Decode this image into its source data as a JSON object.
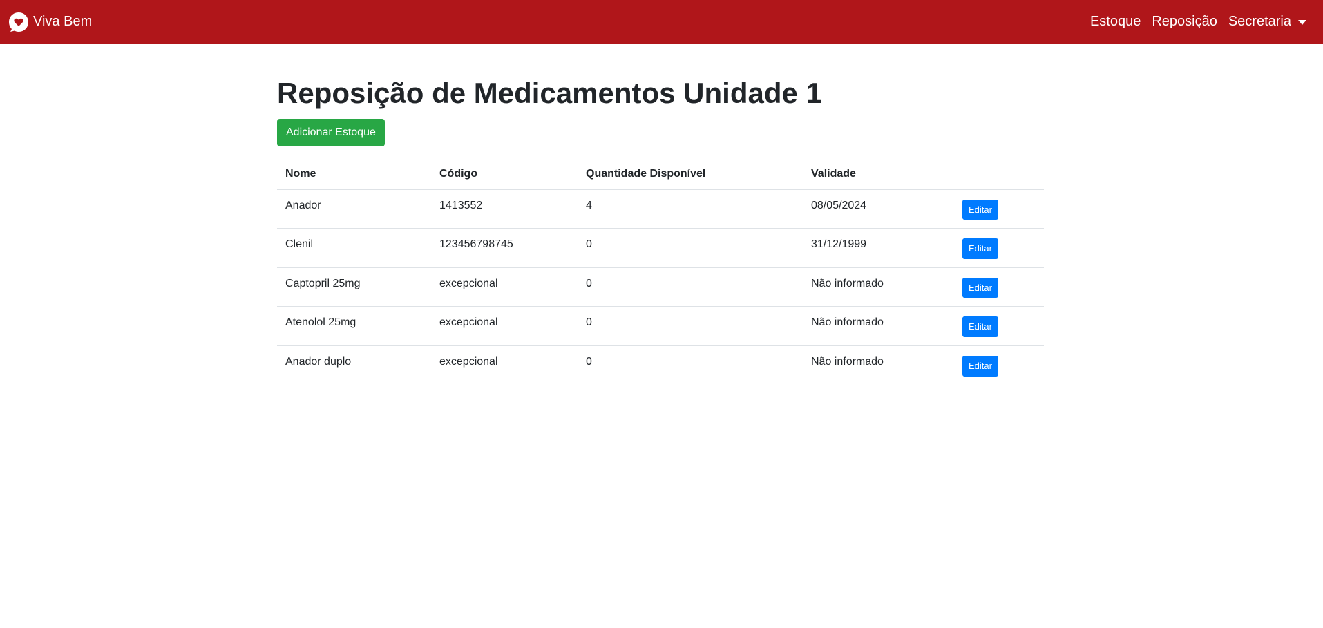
{
  "navbar": {
    "brand": "Viva Bem",
    "brand_icon": "heart-chat-icon",
    "links": [
      {
        "label": "Estoque"
      },
      {
        "label": "Reposição"
      }
    ],
    "dropdown_label": "Secretaria",
    "colors": {
      "background": "#b0161a"
    }
  },
  "main": {
    "title": "Reposição de Medicamentos Unidade 1",
    "add_button_label": "Adicionar Estoque",
    "table": {
      "headers": [
        "Nome",
        "Código",
        "Quantidade Disponível",
        "Validade",
        ""
      ],
      "rows": [
        {
          "nome": "Anador",
          "codigo": "1413552",
          "quantidade": "4",
          "validade": "08/05/2024",
          "action": "Editar"
        },
        {
          "nome": "Clenil",
          "codigo": "123456798745",
          "quantidade": "0",
          "validade": "31/12/1999",
          "action": "Editar"
        },
        {
          "nome": "Captopril 25mg",
          "codigo": "excepcional",
          "quantidade": "0",
          "validade": "Não informado",
          "action": "Editar"
        },
        {
          "nome": "Atenolol 25mg",
          "codigo": "excepcional",
          "quantidade": "0",
          "validade": "Não informado",
          "action": "Editar"
        },
        {
          "nome": "Anador duplo",
          "codigo": "excepcional",
          "quantidade": "0",
          "validade": "Não informado",
          "action": "Editar"
        }
      ]
    },
    "colors": {
      "success": "#28a745",
      "primary": "#007bff"
    }
  }
}
